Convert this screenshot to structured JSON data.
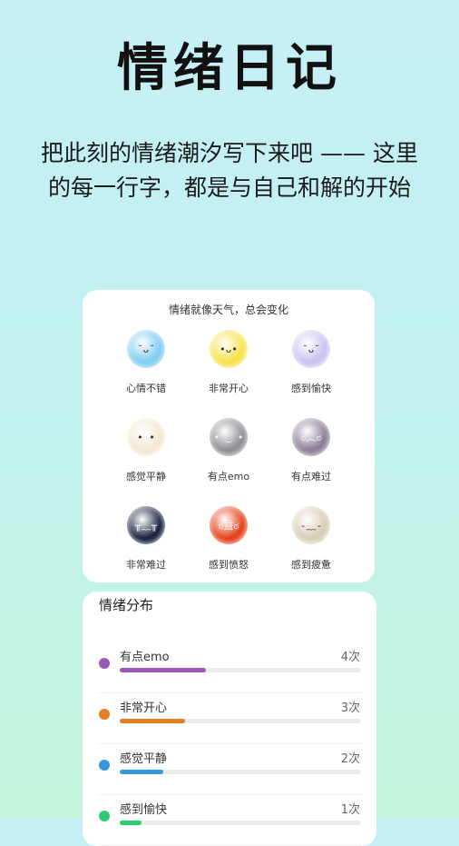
{
  "header": {
    "title": "情绪日记",
    "subtitle_line1": "把此刻的情绪潮汐写下来吧 —— 这里",
    "subtitle_line2": "的每一行字，都是与自己和解的开始"
  },
  "mood_card": {
    "title": "情绪就像天气，总会变化",
    "moods": [
      {
        "label": "心情不错",
        "icon": "blue-fluff-smile-icon",
        "color": "#7fcdf2",
        "face": "˘ᴗ˘"
      },
      {
        "label": "非常开心",
        "icon": "yellow-fluff-smile-icon",
        "color": "#f7e24a",
        "face": "•ᴗ•"
      },
      {
        "label": "感到愉快",
        "icon": "lavender-fluff-smile-icon",
        "color": "#c9c3f0",
        "face": "˘ᴗ˘"
      },
      {
        "label": "感觉平静",
        "icon": "cream-fluff-calm-icon",
        "color": "#f3e9d4",
        "face": "• •"
      },
      {
        "label": "有点emo",
        "icon": "gray-fluff-emo-icon",
        "color": "#8f8f95",
        "face": "• ‿ •"
      },
      {
        "label": "有点难过",
        "icon": "purple-gray-fluff-sad-icon",
        "color": "#8c7f99",
        "face": "ಠ︵ಠ"
      },
      {
        "label": "非常难过",
        "icon": "dark-navy-fluff-crying-icon",
        "color": "#1b2340",
        "face": "╥﹏╥"
      },
      {
        "label": "感到愤怒",
        "icon": "red-fluff-angry-icon",
        "color": "#e6421d",
        "face": "ಠ益ಠ"
      },
      {
        "label": "感到疲惫",
        "icon": "beige-fluff-tired-icon",
        "color": "#d9cdb6",
        "face": "-﹏-"
      }
    ]
  },
  "distribution": {
    "title": "情绪分布",
    "rows": [
      {
        "label": "有点emo",
        "count_text": "4次",
        "fraction": 0.36,
        "color": "#9b59b6"
      },
      {
        "label": "非常开心",
        "count_text": "3次",
        "fraction": 0.27,
        "color": "#e67e22"
      },
      {
        "label": "感觉平静",
        "count_text": "2次",
        "fraction": 0.18,
        "color": "#3498db"
      },
      {
        "label": "感到愉快",
        "count_text": "1次",
        "fraction": 0.09,
        "color": "#2ecc71"
      }
    ]
  }
}
